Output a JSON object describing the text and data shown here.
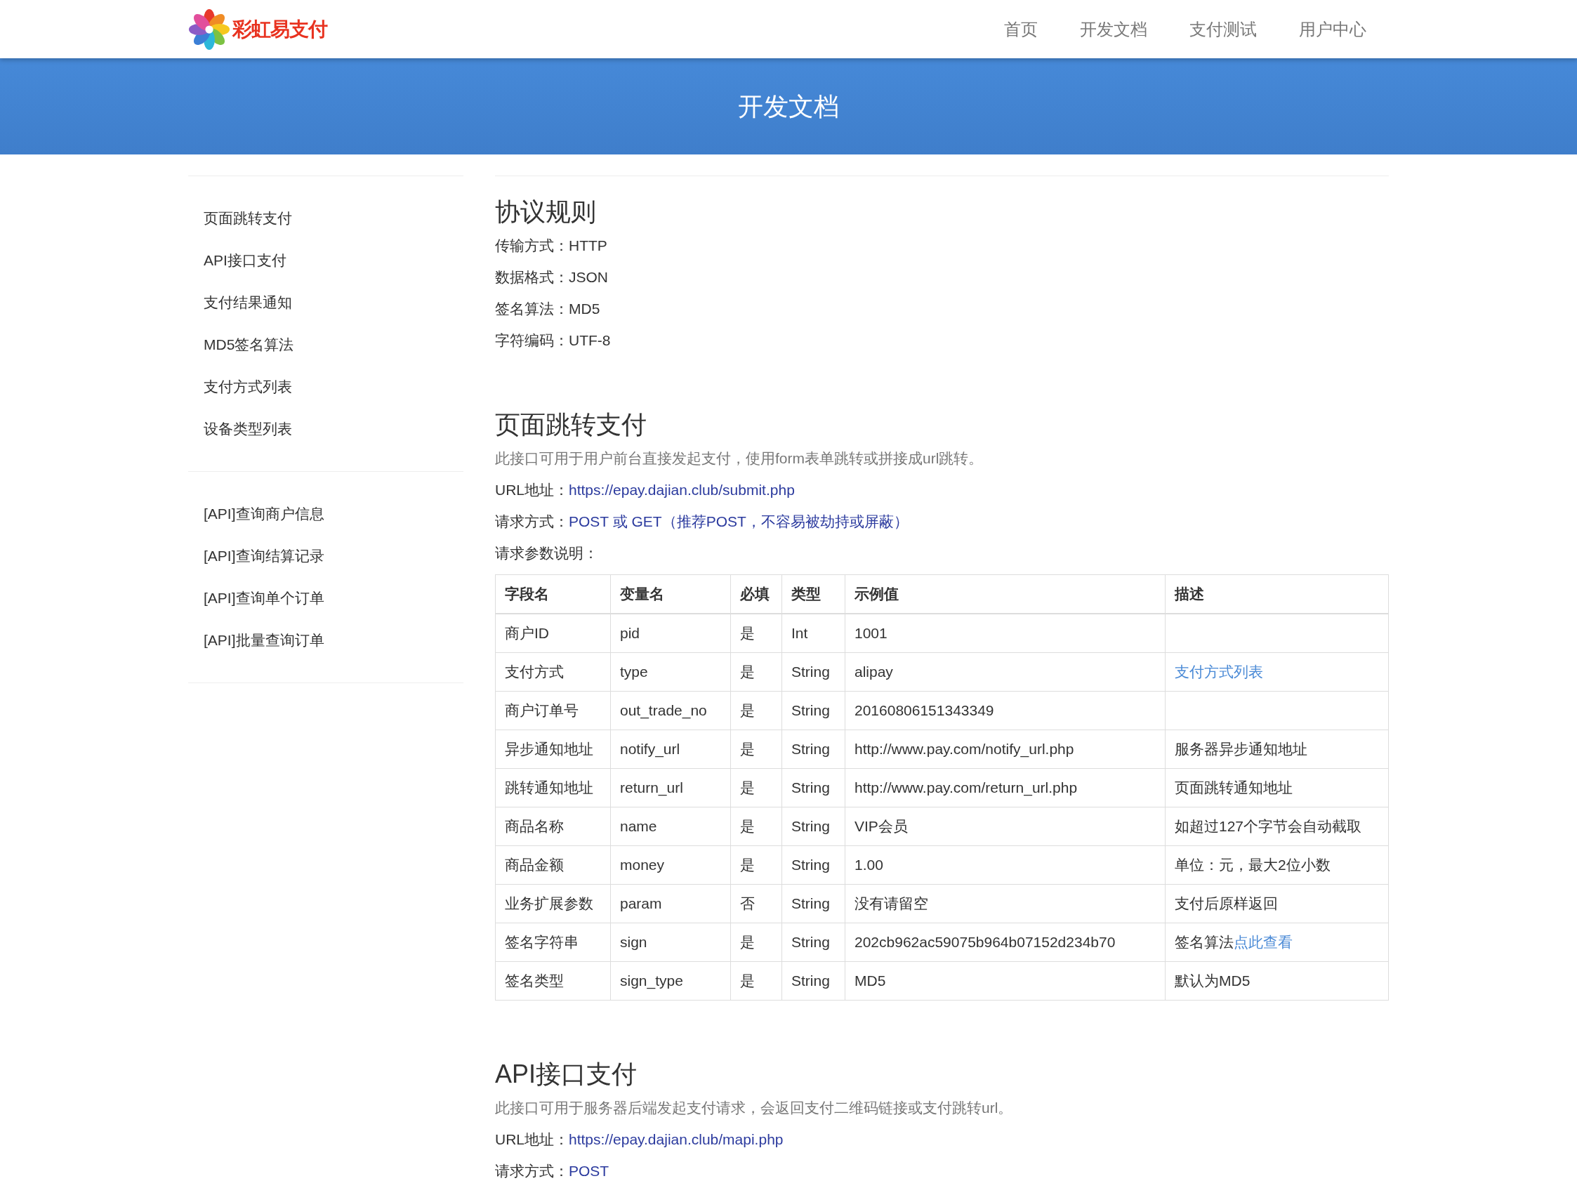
{
  "header": {
    "logo_text": "彩虹易支付",
    "nav": [
      "首页",
      "开发文档",
      "支付测试",
      "用户中心"
    ]
  },
  "banner": {
    "title": "开发文档"
  },
  "sidebar": {
    "groups": [
      [
        "页面跳转支付",
        "API接口支付",
        "支付结果通知",
        "MD5签名算法",
        "支付方式列表",
        "设备类型列表"
      ],
      [
        "[API]查询商户信息",
        "[API]查询结算记录",
        "[API]查询单个订单",
        "[API]批量查询订单"
      ]
    ]
  },
  "sections": [
    {
      "title": "协议规则",
      "fields": [
        {
          "label": "传输方式：",
          "value": "HTTP",
          "kind": "plain"
        },
        {
          "label": "数据格式：",
          "value": "JSON",
          "kind": "plain"
        },
        {
          "label": "签名算法：",
          "value": "MD5",
          "kind": "plain"
        },
        {
          "label": "字符编码：",
          "value": "UTF-8",
          "kind": "plain"
        }
      ]
    },
    {
      "title": "页面跳转支付",
      "description": "此接口可用于用户前台直接发起支付，使用form表单跳转或拼接成url跳转。",
      "fields": [
        {
          "label": "URL地址：",
          "value": "https://epay.dajian.club/submit.php",
          "kind": "highlight"
        },
        {
          "label": "请求方式：",
          "value": "POST 或 GET（推荐POST，不容易被劫持或屏蔽）",
          "kind": "highlight"
        },
        {
          "label": "请求参数说明："
        }
      ],
      "table": {
        "columns": [
          "字段名",
          "变量名",
          "必填",
          "类型",
          "示例值",
          "描述"
        ],
        "rows": [
          {
            "cells": [
              "商户ID",
              "pid",
              "是",
              "Int",
              "1001"
            ]
          },
          {
            "cells": [
              "支付方式",
              "type",
              "是",
              "String",
              "alipay"
            ],
            "description": {
              "link": "支付方式列表"
            }
          },
          {
            "cells": [
              "商户订单号",
              "out_trade_no",
              "是",
              "String",
              "20160806151343349"
            ]
          },
          {
            "cells": [
              "异步通知地址",
              "notify_url",
              "是",
              "String",
              "http://www.pay.com/notify_url.php"
            ],
            "description": {
              "text": "服务器异步通知地址"
            }
          },
          {
            "cells": [
              "跳转通知地址",
              "return_url",
              "是",
              "String",
              "http://www.pay.com/return_url.php"
            ],
            "description": {
              "text": "页面跳转通知地址"
            }
          },
          {
            "cells": [
              "商品名称",
              "name",
              "是",
              "String",
              "VIP会员"
            ],
            "description": {
              "text": "如超过127个字节会自动截取"
            }
          },
          {
            "cells": [
              "商品金额",
              "money",
              "是",
              "String",
              "1.00"
            ],
            "description": {
              "text": "单位：元，最大2位小数"
            }
          },
          {
            "cells": [
              "业务扩展参数",
              "param",
              "否",
              "String",
              "没有请留空"
            ],
            "description": {
              "text": "支付后原样返回"
            }
          },
          {
            "cells": [
              "签名字符串",
              "sign",
              "是",
              "String",
              "202cb962ac59075b964b07152d234b70"
            ],
            "description": {
              "text": "签名算法",
              "link": "点此查看"
            }
          },
          {
            "cells": [
              "签名类型",
              "sign_type",
              "是",
              "String",
              "MD5"
            ],
            "description": {
              "text": "默认为MD5"
            }
          }
        ]
      }
    },
    {
      "title": "API接口支付",
      "description": "此接口可用于服务器后端发起支付请求，会返回支付二维码链接或支付跳转url。",
      "fields": [
        {
          "label": "URL地址：",
          "value": "https://epay.dajian.club/mapi.php",
          "kind": "highlight"
        },
        {
          "label": "请求方式：",
          "value": "POST",
          "kind": "highlight"
        }
      ]
    }
  ]
}
